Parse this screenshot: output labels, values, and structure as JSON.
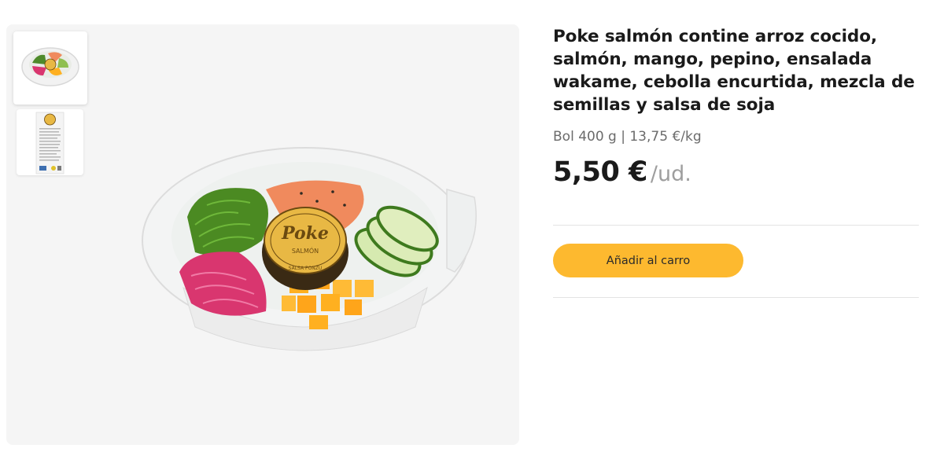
{
  "product": {
    "title": "Poke salmón contine arroz cocido, salmón, mango, pepino, ensalada wakame, cebolla encurtida, mezcla de semillas y salsa de soja",
    "size_line": "Bol 400 g | 13,75 €/kg",
    "price": "5,50 €",
    "unit": "/ud."
  },
  "actions": {
    "add_to_cart_label": "Añadir al carro"
  },
  "images": {
    "lid_brand": "Poke",
    "lid_subtitle": "SALMÓN",
    "lid_footer": "SALSA PONZU"
  },
  "colors": {
    "button": "#fdb92f",
    "gallery_bg": "#f5f5f5"
  }
}
